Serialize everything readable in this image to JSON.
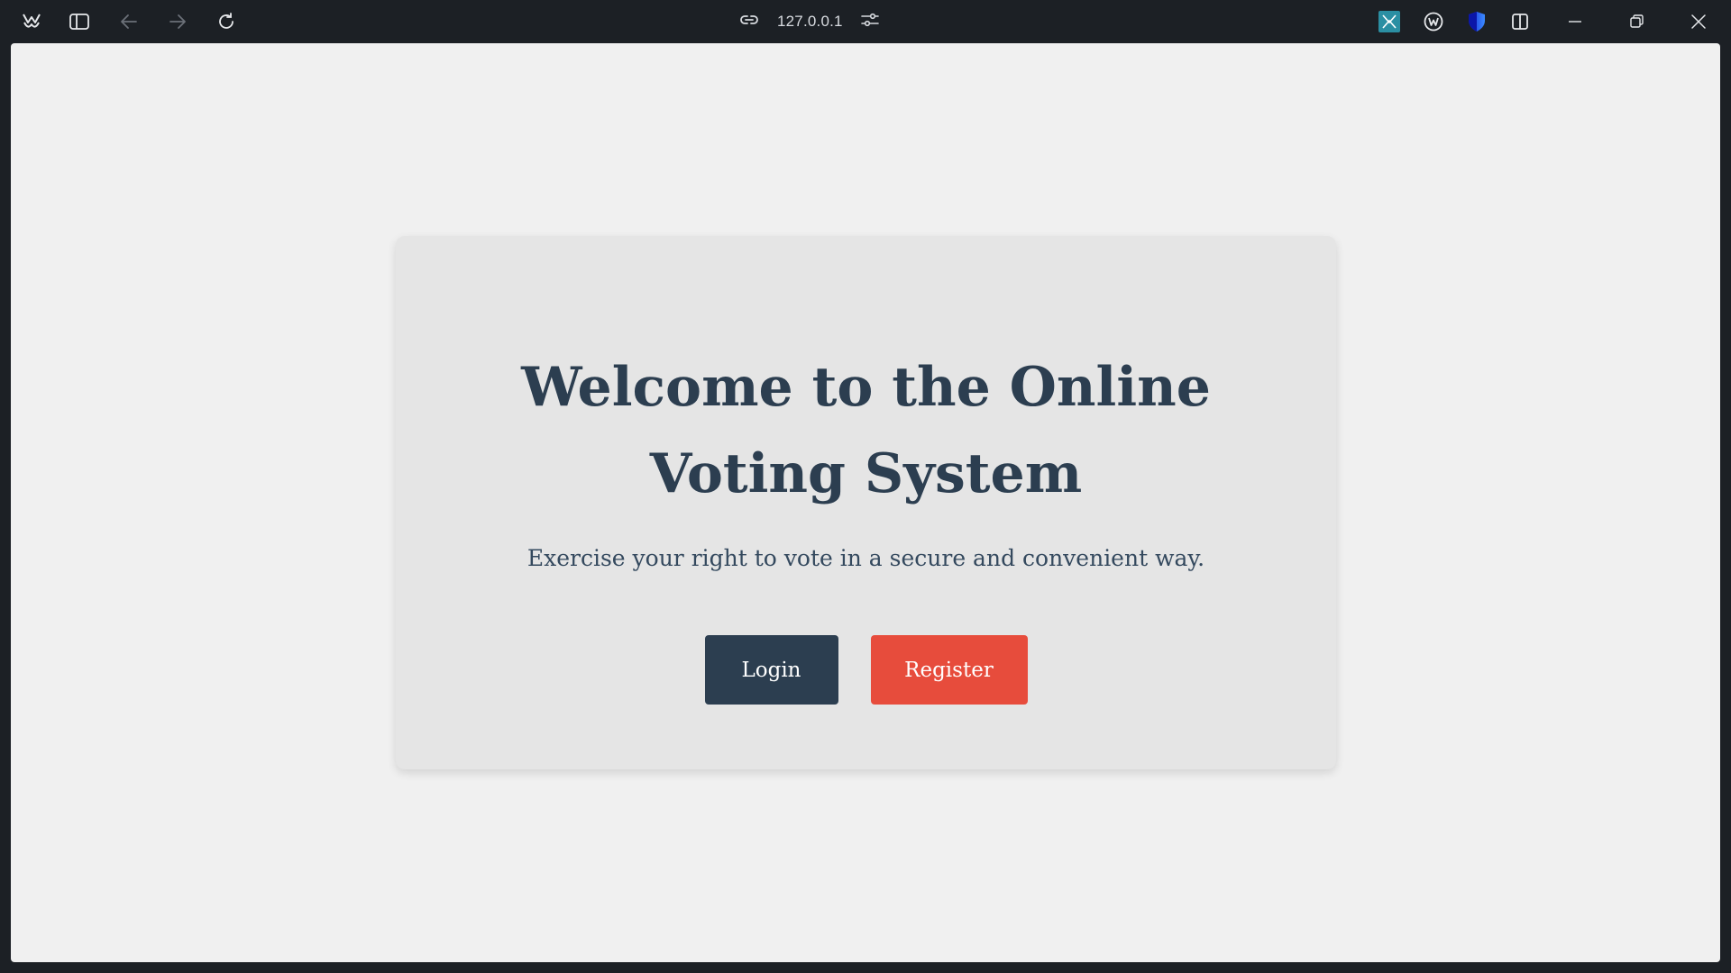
{
  "browser": {
    "url": "127.0.0.1",
    "toolbar_icons": [
      "app-menu-icon",
      "sidebar-toggle-icon",
      "back-icon",
      "forward-icon",
      "reload-icon",
      "link-icon",
      "site-settings-icon",
      "extension-icon",
      "wallet-icon",
      "shield-icon",
      "split-view-icon",
      "minimize-icon",
      "restore-icon",
      "close-icon"
    ]
  },
  "page": {
    "title": "Welcome to the Online Voting System",
    "tagline": "Exercise your right to vote in a secure and convenient way.",
    "login_label": "Login",
    "register_label": "Register"
  },
  "colors": {
    "primary": "#2c3e50",
    "accent": "#e74c3c",
    "card_bg": "#e5e5e5",
    "page_bg": "#f0f0f0"
  }
}
